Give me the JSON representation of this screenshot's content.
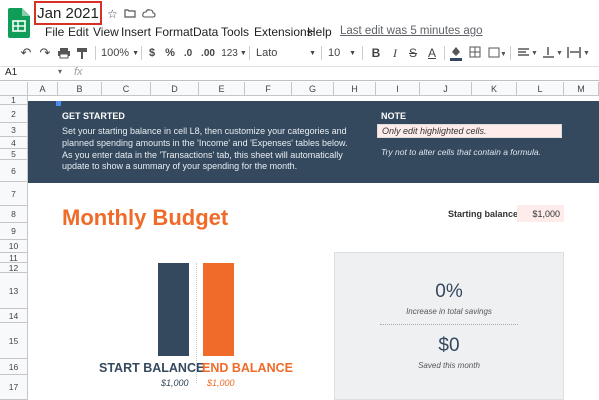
{
  "app": {
    "doc_title": "Jan 2021",
    "menu": [
      "File",
      "Edit",
      "View",
      "Insert",
      "Format",
      "Data",
      "Tools",
      "Extensions",
      "Help"
    ],
    "last_edit": "Last edit was 5 minutes ago"
  },
  "toolbar": {
    "zoom": "100%",
    "currency": "$",
    "percent": "%",
    "decrease_decimal": ".0",
    "increase_decimal": ".00",
    "more_formats": "123",
    "font": "Lato",
    "font_size": "10",
    "bold": "B",
    "italic": "I",
    "strikethrough": "S",
    "text_color": "A"
  },
  "formula_bar": {
    "cell_ref": "A1",
    "fx": "fx",
    "value": ""
  },
  "columns": [
    "A",
    "B",
    "C",
    "D",
    "E",
    "F",
    "G",
    "H",
    "I",
    "J",
    "K",
    "L",
    "M"
  ],
  "rows": [
    "1",
    "2",
    "3",
    "4",
    "5",
    "6",
    "7",
    "8",
    "9",
    "10",
    "11",
    "12",
    "13",
    "14",
    "15",
    "16",
    "17"
  ],
  "banner": {
    "heading": "GET STARTED",
    "text_1": "Set your starting balance in cell L8, then customize your categories and",
    "text_2": "planned spending amounts in the 'Income' and 'Expenses' tables below.",
    "text_3": "As you enter data in the 'Transactions' tab, this sheet will automatically",
    "text_4": "update to show a summary of your spending for the month.",
    "note_heading": "NOTE",
    "note_input": "Only edit highlighted cells.",
    "note_sub": "Try not to alter cells that contain a formula."
  },
  "budget": {
    "title": "Monthly Budget",
    "starting_balance_label": "Starting balance:",
    "starting_balance_value": "$1,000",
    "start_label": "START BALANCE",
    "start_value": "$1,000",
    "end_label": "END BALANCE",
    "end_value": "$1,000",
    "savings_pct": "0%",
    "savings_label": "Increase in total savings",
    "saved_value": "$0",
    "saved_label": "Saved this month"
  },
  "colors": {
    "accent_orange": "#f06b2a",
    "navy": "#34495e",
    "sheets_green": "#0f9d58",
    "highlight": "#fdecea"
  }
}
